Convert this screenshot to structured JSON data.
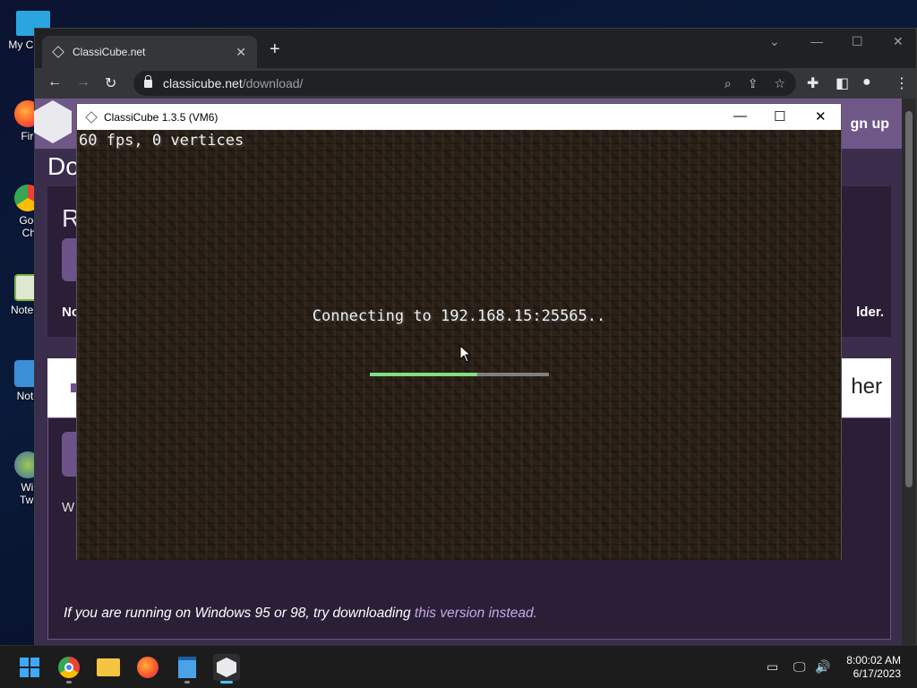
{
  "desktop": {
    "icons": [
      {
        "label": "My Co",
        "icon": "computer-icon"
      },
      {
        "label": "Fire",
        "icon": "firefox-icon"
      },
      {
        "label": "Goo",
        "label2": "Chr",
        "icon": "chrome-icon"
      },
      {
        "label": "Notep",
        "icon": "notepad-icon"
      },
      {
        "label": "Note",
        "icon": "notepad-icon"
      },
      {
        "label": "Win",
        "label2": "Twe",
        "icon": "winaero-icon"
      }
    ]
  },
  "browser": {
    "tab_title": "ClassiCube.net",
    "url_host": "classicube.net",
    "url_path": "/download/"
  },
  "page": {
    "signup": "gn up",
    "heading": "Do",
    "section_r": "R",
    "no_text": "No",
    "folder_text": "lder.",
    "other_text": "her",
    "w_text": "W",
    "note_prefix": "If you are running on Windows 95 or 98, try downloading ",
    "note_link": "this version instead."
  },
  "game": {
    "title": "ClassiCube 1.3.5 (VM6)",
    "fps_text": "60 fps, 0 vertices",
    "status": "Connecting to 192.168.15:25565..",
    "progress": 0.6
  },
  "taskbar": {
    "apps": [
      "start-icon",
      "chrome-icon",
      "file-explorer-icon",
      "firefox-icon",
      "notepad-icon",
      "classicube-icon"
    ],
    "time": "8:00:02 AM",
    "date": "6/17/2023"
  },
  "colors": {
    "accent": "#6f5888",
    "progress_fill": "#7ee07e"
  }
}
